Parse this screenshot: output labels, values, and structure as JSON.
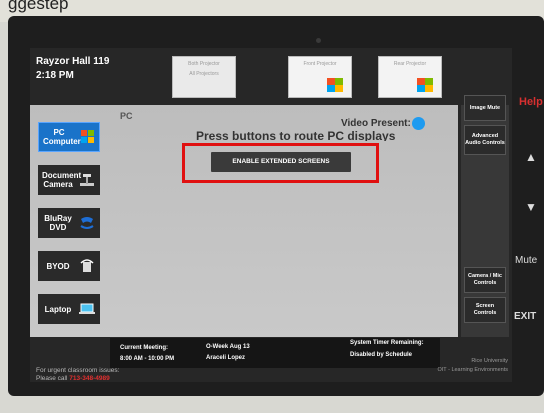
{
  "caption": "ggestep",
  "room": {
    "title": "Rayzor Hall 119",
    "time": "2:18 PM"
  },
  "top_buttons": [
    {
      "label": "Both Projector",
      "sub": "All Projectors"
    },
    {
      "label": "Front Projector"
    },
    {
      "label": "Rear Projector"
    },
    {
      "label": "Image Mute"
    }
  ],
  "main": {
    "source_label": "PC",
    "video_present_label": "Video Present:",
    "route_text": "Press buttons to route PC displays",
    "enable_button": "ENABLE EXTENDED SCREENS"
  },
  "sources": [
    {
      "label": "PC Computer",
      "active": true
    },
    {
      "label": "Document Camera",
      "active": false
    },
    {
      "label": "BluRay DVD",
      "active": false
    },
    {
      "label": "BYOD",
      "active": false
    },
    {
      "label": "Laptop",
      "active": false
    }
  ],
  "right_buttons": [
    {
      "label": "Image Mute"
    },
    {
      "label": "Advanced Audio Controls"
    },
    {
      "label": "Camera / Mic Controls"
    },
    {
      "label": "Screen Controls"
    }
  ],
  "status_bar": {
    "current_meeting_label": "Current Meeting:",
    "current_meeting_time": "8:00 AM - 10:00 PM",
    "meeting_title": "O-Week Aug 13",
    "meeting_person": "Araceli Lopez",
    "timer_label": "System Timer Remaining:",
    "timer_value": "Disabled by Schedule"
  },
  "footer": {
    "urgent": "For urgent classroom issues:",
    "call": "Please call",
    "phone": "713-348-4989",
    "university": "Rice University",
    "department": "OIT - Learning Environments"
  },
  "wall": {
    "help": "Help",
    "up": "▲",
    "down": "▼",
    "mute": "Mute",
    "exit": "EXIT"
  },
  "colors": {
    "active_source": "#1a73c9",
    "video_indicator": "#1e9bf0",
    "highlight": "#e01010"
  }
}
